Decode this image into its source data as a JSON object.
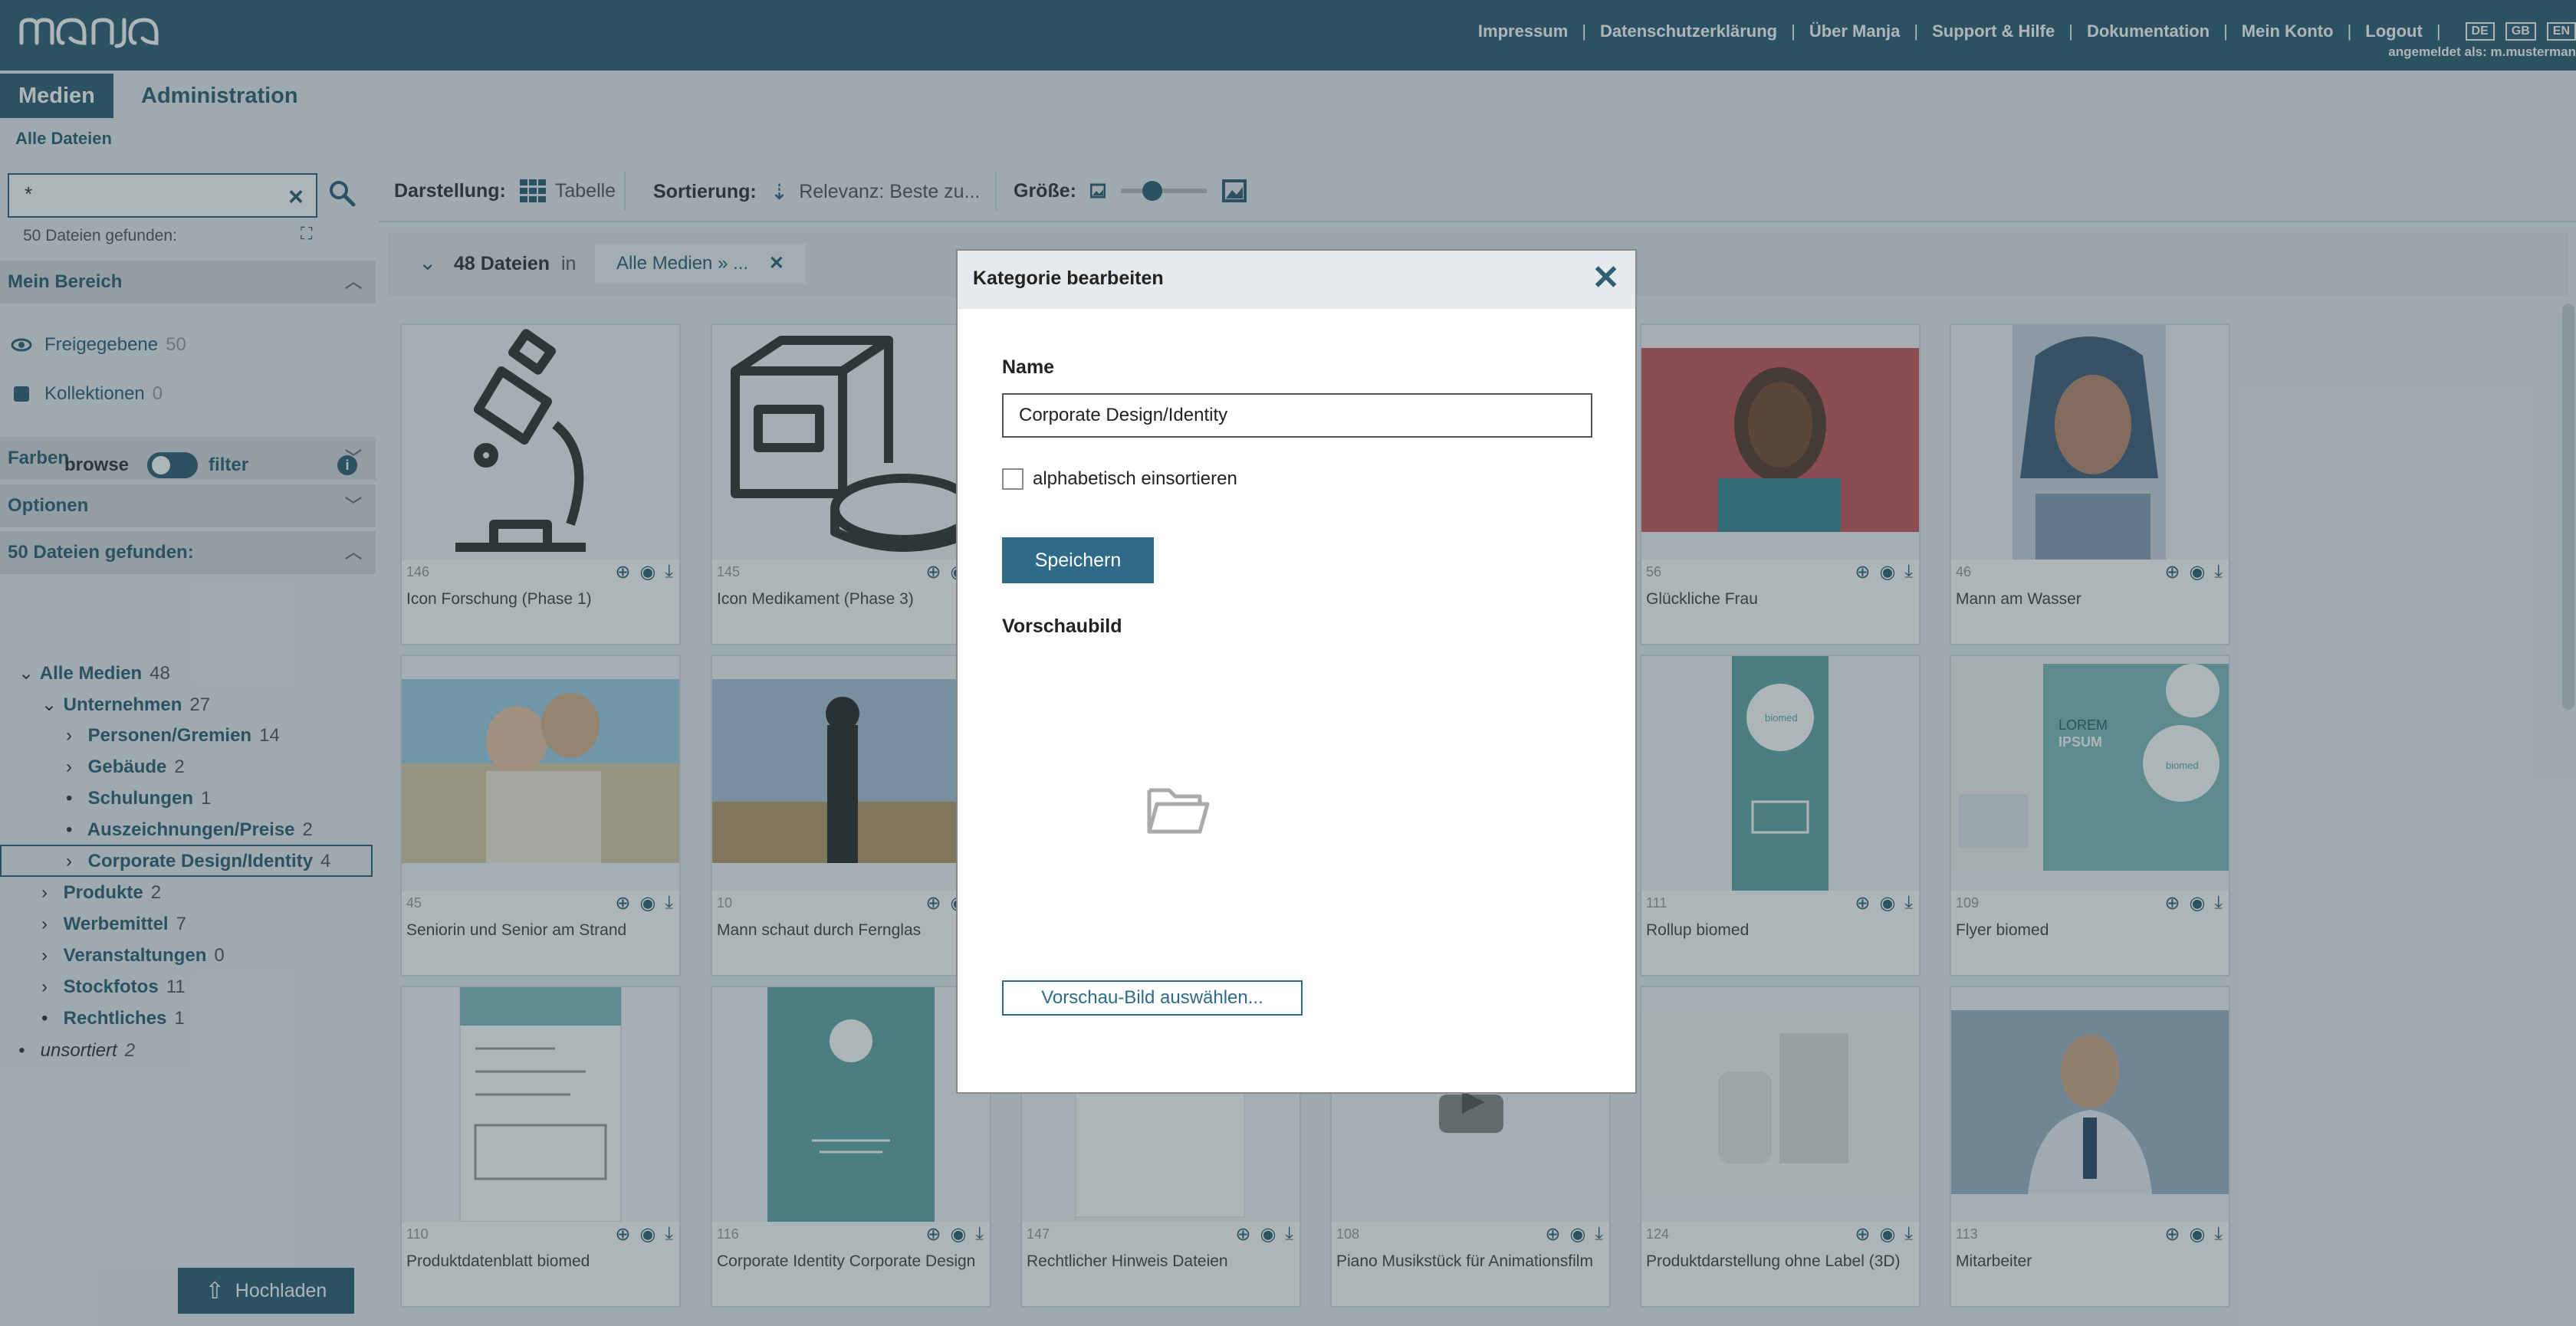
{
  "app": {
    "logo_text": "manja",
    "top_links": [
      "Impressum",
      "Datenschutzerklärung",
      "Über Manja",
      "Support & Hilfe",
      "Dokumentation",
      "Mein Konto",
      "Logout"
    ],
    "languages": [
      "DE",
      "GB",
      "EN"
    ],
    "user_line": "angemeldet als: m.musterman"
  },
  "nav": {
    "tabs": [
      "Medien",
      "Administration"
    ],
    "breadcrumb": "Alle Dateien"
  },
  "sidebar": {
    "search_value": "*",
    "found_top": "50 Dateien gefunden:",
    "sections": {
      "mein_bereich": "Mein Bereich",
      "farben": "Farben",
      "optionen": "Optionen",
      "found": "50 Dateien gefunden:"
    },
    "mein_bereich_items": [
      {
        "label": "Freigegebene",
        "count": "50"
      },
      {
        "label": "Kollektionen",
        "count": "0"
      }
    ],
    "browse_label": "browse",
    "filter_label": "filter",
    "tree": [
      {
        "label": "Alle Medien",
        "count": "48",
        "marker": "⌄"
      },
      {
        "label": "Unternehmen",
        "count": "27",
        "marker": "⌄"
      },
      {
        "label": "Personen/Gremien",
        "count": "14",
        "marker": "›"
      },
      {
        "label": "Gebäude",
        "count": "2",
        "marker": "›"
      },
      {
        "label": "Schulungen",
        "count": "1",
        "marker": "•"
      },
      {
        "label": "Auszeichnungen/Preise",
        "count": "2",
        "marker": "•"
      },
      {
        "label": "Corporate Design/Identity",
        "count": "4",
        "marker": "›"
      },
      {
        "label": "Produkte",
        "count": "2",
        "marker": "›"
      },
      {
        "label": "Werbemittel",
        "count": "7",
        "marker": "›"
      },
      {
        "label": "Veranstaltungen",
        "count": "0",
        "marker": "›"
      },
      {
        "label": "Stockfotos",
        "count": "11",
        "marker": "›"
      },
      {
        "label": "Rechtliches",
        "count": "1",
        "marker": "•"
      },
      {
        "label": "unsortiert",
        "count": "2",
        "marker": "•"
      }
    ],
    "upload_label": "Hochladen"
  },
  "toolbar": {
    "darstellung_label": "Darstellung:",
    "darstellung_value": "Tabelle",
    "sortierung_label": "Sortierung:",
    "sortierung_value": "Relevanz: Beste zu...",
    "groesse_label": "Größe:"
  },
  "results": {
    "count": "48 Dateien",
    "in_label": "in",
    "filter_chip": "Alle Medien » ..."
  },
  "tiles": [
    {
      "id": "146",
      "title": "Icon Forschung (Phase 1)"
    },
    {
      "id": "145",
      "title": "Icon Medikament (Phase 3)"
    },
    {
      "id": "",
      "title": ""
    },
    {
      "id": "",
      "title": ""
    },
    {
      "id": "56",
      "title": "Glückliche Frau"
    },
    {
      "id": "46",
      "title": "Mann am Wasser"
    },
    {
      "id": "45",
      "title": "Seniorin und Senior am Strand"
    },
    {
      "id": "10",
      "title": "Mann schaut durch Fernglas"
    },
    {
      "id": "",
      "title": ""
    },
    {
      "id": "",
      "title": ""
    },
    {
      "id": "111",
      "title": "Rollup biomed"
    },
    {
      "id": "109",
      "title": "Flyer biomed"
    },
    {
      "id": "110",
      "title": "Produktdatenblatt biomed"
    },
    {
      "id": "116",
      "title": "Corporate Identity Corporate Design"
    },
    {
      "id": "147",
      "title": "Rechtlicher Hinweis Dateien"
    },
    {
      "id": "108",
      "title": "Piano Musikstück für Animationsfilm"
    },
    {
      "id": "124",
      "title": "Produktdarstellung ohne Label (3D)"
    },
    {
      "id": "113",
      "title": "Mitarbeiter"
    }
  ],
  "thumb_text": {
    "biomed": "biomed",
    "lorem": "LOREM",
    "ipsum": "IPSUM"
  },
  "modal": {
    "title": "Kategorie bearbeiten",
    "name_label": "Name",
    "name_value": "Corporate Design/Identity",
    "alpha_label": "alphabetisch einsortieren",
    "save_label": "Speichern",
    "preview_label": "Vorschaubild",
    "pick_label": "Vorschau-Bild auswählen..."
  },
  "colors": {
    "brand": "#2f5f73",
    "button": "#2f6a89"
  }
}
